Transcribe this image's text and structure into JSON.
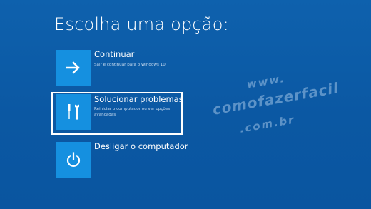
{
  "title": "Escolha uma opção:",
  "options": [
    {
      "label": "Continuar",
      "description": "Sair e continuar para o Windows 10",
      "icon": "arrow-right-icon"
    },
    {
      "label": "Solucionar problemas",
      "description": "Reiniciar o computador ou ver opções avançadas",
      "icon": "tools-icon",
      "selected": true
    },
    {
      "label": "Desligar o computador",
      "description": "",
      "icon": "power-icon"
    }
  ],
  "watermark": {
    "line1": "www.",
    "line2": "comofazerfacil",
    "line3": ".com.br"
  },
  "colors": {
    "background": "#0d5ca7",
    "tile": "#1590e0",
    "text": "#ffffff"
  }
}
